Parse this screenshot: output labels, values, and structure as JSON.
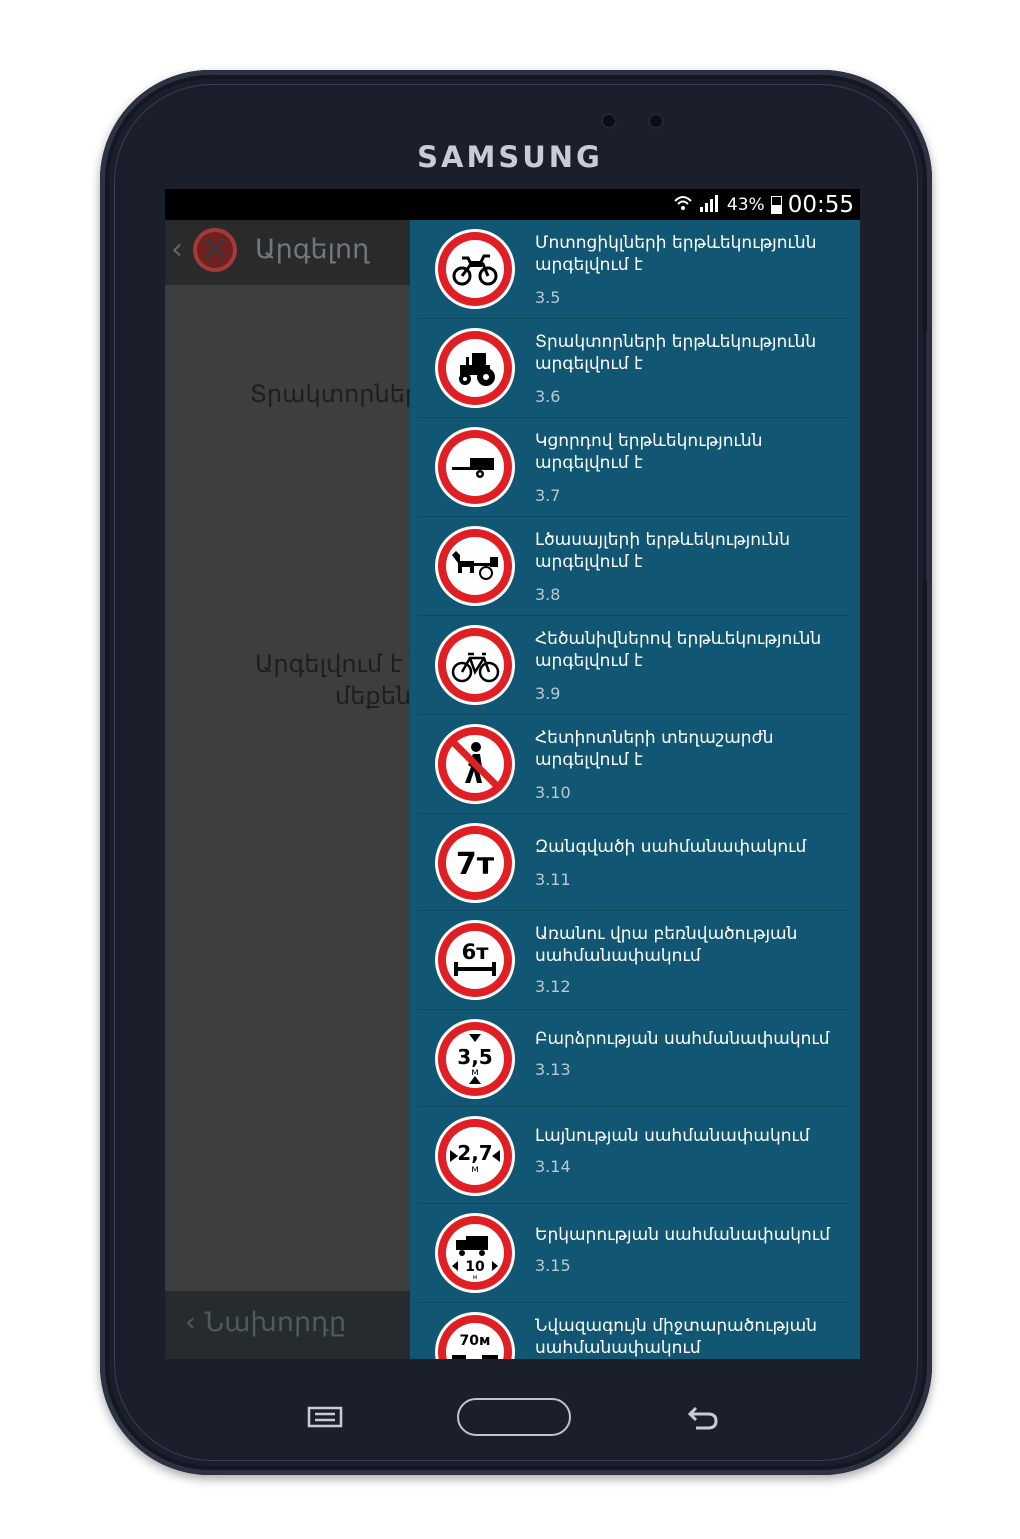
{
  "device": {
    "brand": "SAMSUNG"
  },
  "status_bar": {
    "battery_percent": "43%",
    "time": "00:55"
  },
  "left_panel": {
    "header_title": "Արգելող",
    "text_line1": "Տրակտորներ",
    "text_line2": "Արգելվում է ն",
    "text_line3": "մեքեն",
    "prev_button": "Նախորդը"
  },
  "drawer": {
    "items": [
      {
        "title": "Մոտոցիկլների երթևեկությունն արգելվում է",
        "code": "3.5",
        "icon": "motorcycle-sign"
      },
      {
        "title": "Տրակտորների երթևեկությունն արգելվում է",
        "code": "3.6",
        "icon": "tractor-sign"
      },
      {
        "title": "Կցորդով երթևեկությունն արգելվում է",
        "code": "3.7",
        "icon": "trailer-sign"
      },
      {
        "title": "Լծասայլերի երթևեկությունն արգելվում է",
        "code": "3.8",
        "icon": "horse-cart-sign"
      },
      {
        "title": "Հեծանիվներով երթևեկությունն արգելվում է",
        "code": "3.9",
        "icon": "bicycle-sign"
      },
      {
        "title": "Հետիոտների տեղաշարժն արգելվում է",
        "code": "3.10",
        "icon": "pedestrian-sign"
      },
      {
        "title": "Զանգվածի սահմանափակում",
        "code": "3.11",
        "icon": "mass-limit-sign",
        "sign_text": "7т"
      },
      {
        "title": "Առանու վրա բեռնվածության սահմանափակում",
        "code": "3.12",
        "icon": "axle-load-sign",
        "sign_text": "6т"
      },
      {
        "title": "Բարձրության սահմանափակում",
        "code": "3.13",
        "icon": "height-limit-sign",
        "sign_text": "3,5",
        "sign_unit": "м"
      },
      {
        "title": "Լայնության սահմանափակում",
        "code": "3.14",
        "icon": "width-limit-sign",
        "sign_text": "2,7",
        "sign_unit": "м"
      },
      {
        "title": "Երկարության սահմանափակում",
        "code": "3.15",
        "icon": "length-limit-sign",
        "sign_text": "10",
        "sign_unit": "м"
      },
      {
        "title": "Նվազագույն միջտարածության սահմանափակում",
        "code": "",
        "icon": "distance-limit-sign",
        "sign_text": "70м"
      }
    ]
  },
  "colors": {
    "drawer_bg": "#115672",
    "sign_red": "#e01f25",
    "dim_overlay": "#3e3e3e"
  }
}
